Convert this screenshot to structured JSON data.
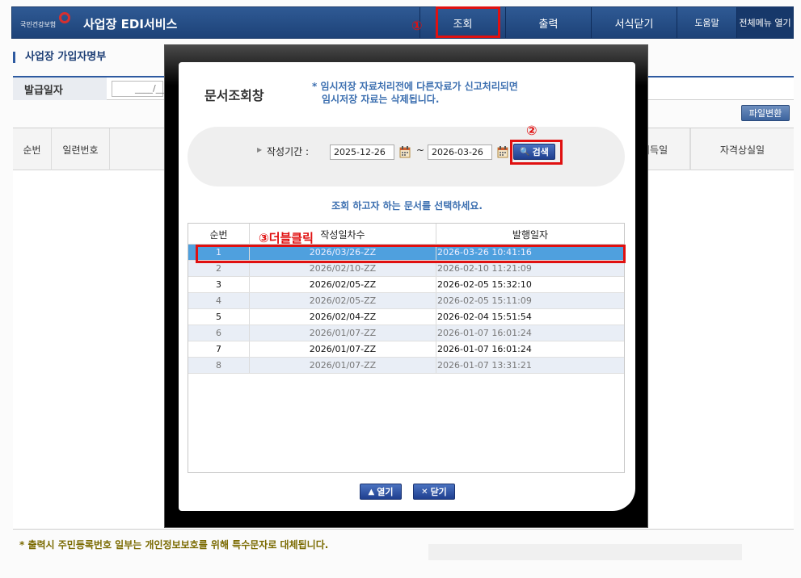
{
  "header": {
    "logo_text": "국민건강보험",
    "brand": "사업장 EDI서비스",
    "nav": {
      "inquiry": "조회",
      "print": "출력",
      "close_forms": "서식닫기",
      "help": "도움말",
      "all_menu": "전체메뉴 열기"
    },
    "step1": "①"
  },
  "background_page": {
    "title": "사업장 가입자명부",
    "filter_label": "발급일자",
    "filter_value": "____/__",
    "file_convert": "파일변환",
    "table_headers": {
      "seq": "순번",
      "serial": "일련번호",
      "acquisition": "취득일",
      "loss": "자격상실일"
    },
    "notice": "* 출력시 주민등록번호 일부는 개인정보보호를 위해 특수문자로 대체됩니다."
  },
  "modal": {
    "title": "문서조회창",
    "warning_line1": "* 임시저장 자료처리전에 다른자료가 신고처리되면",
    "warning_line2": "임시저장 자료는 삭제됩니다.",
    "period_label": "작성기간 :",
    "date_from": "2025-12-26",
    "date_to": "2026-03-26",
    "tilde": "~",
    "search_button": "검색",
    "step2": "②",
    "select_message": "조회 하고자 하는 문서를 선택하세요.",
    "grid_headers": {
      "seq": "순번",
      "title": "작성일차수",
      "issue_date": "발행일자"
    },
    "rows": [
      {
        "seq": "1",
        "title": "2026/03/26-ZZ",
        "date": "2026-03-26 10:41:16"
      },
      {
        "seq": "2",
        "title": "2026/02/10-ZZ",
        "date": "2026-02-10 11:21:09"
      },
      {
        "seq": "3",
        "title": "2026/02/05-ZZ",
        "date": "2026-02-05 15:32:10"
      },
      {
        "seq": "4",
        "title": "2026/02/05-ZZ",
        "date": "2026-02-05 15:11:09"
      },
      {
        "seq": "5",
        "title": "2026/02/04-ZZ",
        "date": "2026-02-04 15:51:54"
      },
      {
        "seq": "6",
        "title": "2026/01/07-ZZ",
        "date": "2026-01-07 16:01:24"
      },
      {
        "seq": "7",
        "title": "2026/01/07-ZZ",
        "date": "2026-01-07 16:01:24"
      },
      {
        "seq": "8",
        "title": "2026/01/07-ZZ",
        "date": "2026-01-07 13:31:21"
      }
    ],
    "step3": "③더블클릭",
    "open_button": "열기",
    "close_button": "닫기"
  },
  "colors": {
    "header_blue": "#1d4278",
    "accent_blue": "#3c6fb0",
    "selected_row": "#4fa0de",
    "marker_red": "#e01010"
  }
}
